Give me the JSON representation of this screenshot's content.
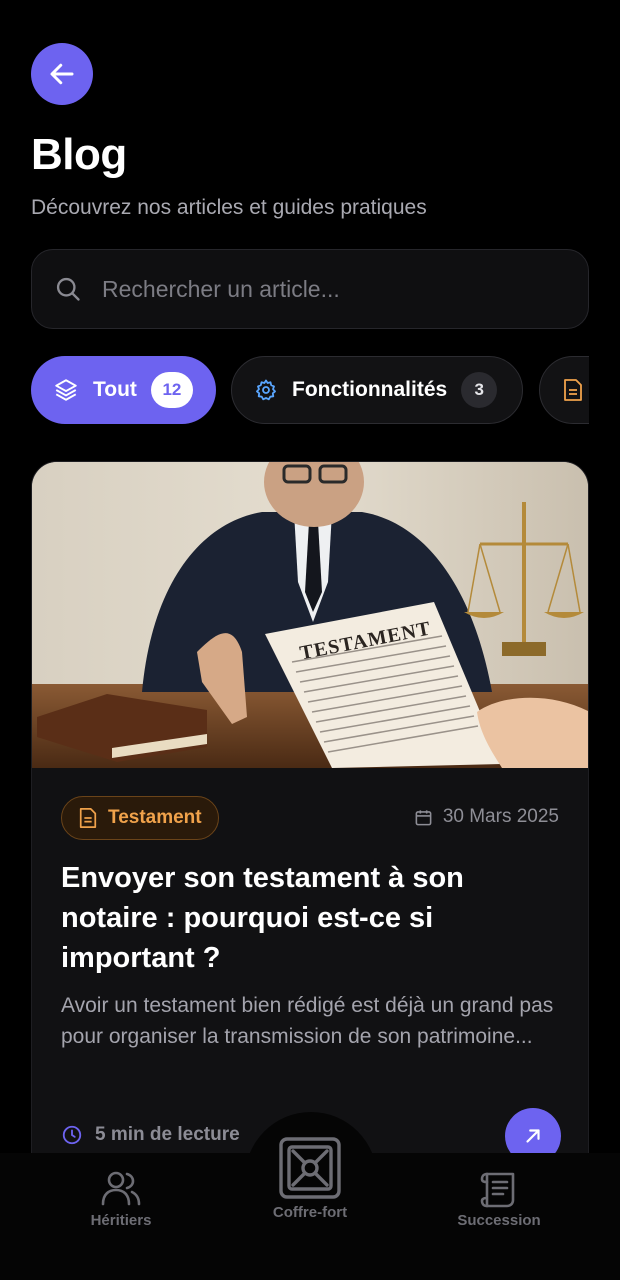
{
  "header": {
    "title": "Blog",
    "subtitle": "Découvrez nos articles et guides pratiques"
  },
  "search": {
    "placeholder": "Rechercher un article...",
    "value": ""
  },
  "categories": [
    {
      "label": "Tout",
      "count": "12",
      "active": true,
      "icon": "layers-icon"
    },
    {
      "label": "Fonctionnalités",
      "count": "3",
      "active": false,
      "icon": "gear-icon"
    },
    {
      "label": "",
      "count": "",
      "active": false,
      "icon": "document-icon"
    }
  ],
  "article": {
    "category": "Testament",
    "date": "30 Mars 2025",
    "title": "Envoyer son testament à son notaire : pourquoi est-ce si important ?",
    "excerpt": "Avoir un testament bien rédigé est déjà un grand pas pour organiser la transmission de son patrimoine...",
    "read_time": "5 min de lecture",
    "image_caption": "TESTAMENT"
  },
  "bottom_nav": {
    "heirs": "Héritiers",
    "safe": "Coffre-fort",
    "succession": "Succession"
  },
  "colors": {
    "accent": "#6d63f0",
    "background": "#000000",
    "category_orange": "#f0a24b"
  }
}
